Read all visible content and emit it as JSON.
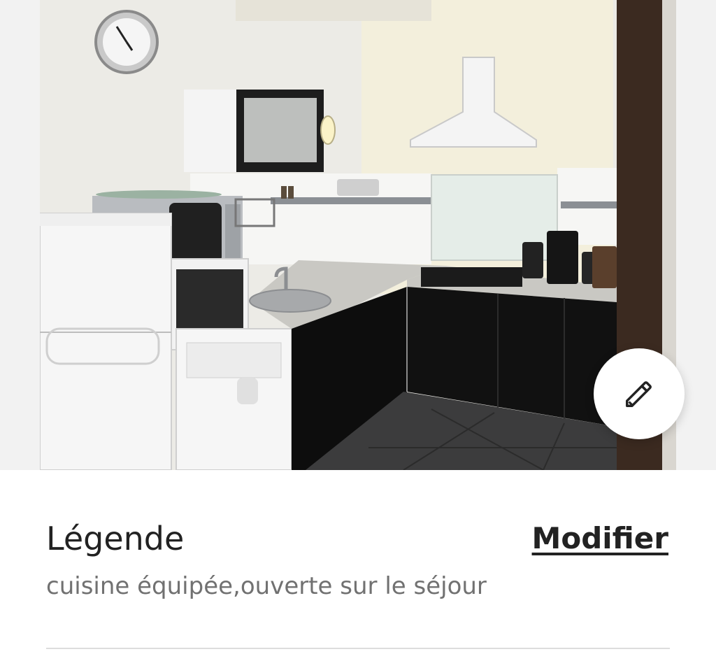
{
  "photo": {
    "alt": "",
    "edit_icon": "pencil-icon"
  },
  "caption": {
    "title": "Légende",
    "modify_label": "Modifier",
    "text": "cuisine équipée,ouverte sur le séjour"
  }
}
